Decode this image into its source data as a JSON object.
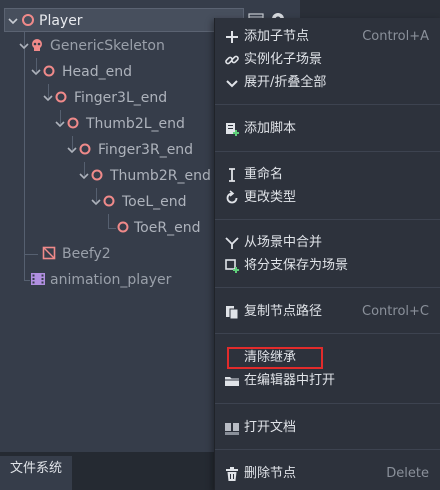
{
  "scene_tree": {
    "nodes": [
      {
        "label": "Player",
        "icon": "node3d-ring-icon"
      },
      {
        "label": "GenericSkeleton",
        "icon": "skeleton-icon"
      },
      {
        "label": "Head_end",
        "icon": "bone-ring-icon"
      },
      {
        "label": "Finger3L_end",
        "icon": "bone-ring-icon"
      },
      {
        "label": "Thumb2L_end",
        "icon": "bone-ring-icon"
      },
      {
        "label": "Finger3R_end",
        "icon": "bone-ring-icon"
      },
      {
        "label": "Thumb2R_end",
        "icon": "bone-ring-icon"
      },
      {
        "label": "ToeL_end",
        "icon": "bone-ring-icon"
      },
      {
        "label": "ToeR_end",
        "icon": "bone-ring-icon"
      },
      {
        "label": "Beefy2",
        "icon": "mesh-icon"
      },
      {
        "label": "animation_player",
        "icon": "animation-player-icon"
      }
    ]
  },
  "bottom_dock": {
    "tab_label": "文件系统"
  },
  "context_menu": {
    "items": [
      {
        "label": "添加子节点",
        "shortcut": "Control+A",
        "icon": "add-icon"
      },
      {
        "label": "实例化子场景",
        "shortcut": "",
        "icon": "link-icon"
      },
      {
        "label": "展开/折叠全部",
        "shortcut": "",
        "icon": "chevron-down-icon"
      },
      {
        "label": "添加脚本",
        "shortcut": "",
        "icon": "script-add-icon"
      },
      {
        "label": "重命名",
        "shortcut": "",
        "icon": "rename-icon"
      },
      {
        "label": "更改类型",
        "shortcut": "",
        "icon": "rotate-icon"
      },
      {
        "label": "从场景中合并",
        "shortcut": "",
        "icon": "merge-icon"
      },
      {
        "label": "将分支保存为场景",
        "shortcut": "",
        "icon": "save-branch-icon"
      },
      {
        "label": "复制节点路径",
        "shortcut": "Control+C",
        "icon": "copy-path-icon"
      },
      {
        "label": "清除继承",
        "shortcut": "",
        "icon": ""
      },
      {
        "label": "在编辑器中打开",
        "shortcut": "",
        "icon": "folder-icon"
      },
      {
        "label": "打开文档",
        "shortcut": "",
        "icon": "doc-icon"
      },
      {
        "label": "删除节点",
        "shortcut": "Delete",
        "icon": "trash-icon"
      }
    ]
  },
  "colors": {
    "panel": "#363d4a",
    "menu": "#2d323c",
    "bone": "#f08a8a",
    "highlight_box": "#e22b2b"
  }
}
